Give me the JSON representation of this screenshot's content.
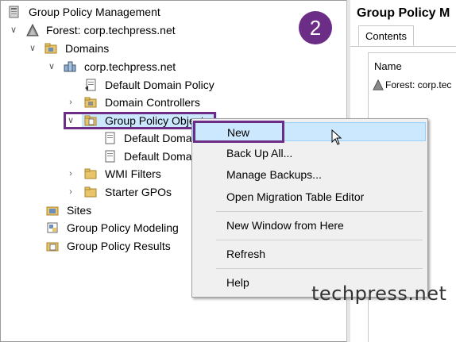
{
  "tree": {
    "root": "Group Policy Management",
    "forest": "Forest: corp.techpress.net",
    "domains": "Domains",
    "domain": "corp.techpress.net",
    "default_domain_policy": "Default Domain Policy",
    "domain_controllers": "Domain Controllers",
    "gpo": "Group Policy Objects",
    "gpo_child1": "Default Domai",
    "gpo_child2": "Default Domai",
    "wmi": "WMI Filters",
    "starter": "Starter GPOs",
    "sites": "Sites",
    "modeling": "Group Policy Modeling",
    "results": "Group Policy Results"
  },
  "right_pane": {
    "title": "Group Policy M",
    "tab": "Contents",
    "column": "Name",
    "row": "Forest: corp.tec"
  },
  "context_menu": {
    "items": [
      "New",
      "Back Up All...",
      "Manage Backups...",
      "Open Migration Table Editor",
      "New Window from Here",
      "Refresh",
      "Help"
    ]
  },
  "step_badge": "2",
  "watermark": "techpress.net",
  "colors": {
    "highlight": "#6b2d86",
    "menu_hover": "#cce8ff",
    "menu_bg": "#f0f0f0"
  }
}
